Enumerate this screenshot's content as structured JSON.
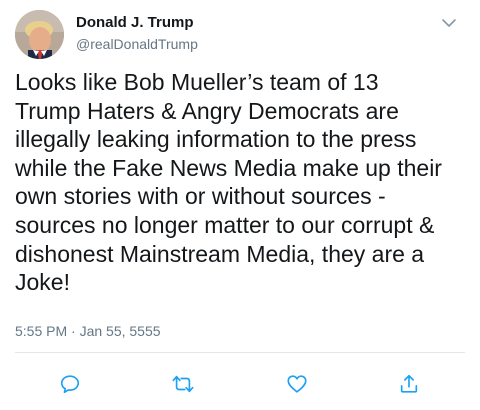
{
  "author": {
    "name": "Donald J. Trump",
    "handle": "@realDonaldTrump"
  },
  "tweet": {
    "text": "Looks like Bob Mueller’s team of 13\nTrump Haters & Angry Democrats are\nillegally leaking information to the press\nwhile the Fake News Media make up their\nown stories with or without sources -\nsources no longer matter to our corrupt &\ndishonest Mainstream Media, they are a\nJoke!",
    "timestamp": "5:55 PM · Jan 55, 5555"
  },
  "icons": {
    "more": "chevron-down-icon",
    "reply": "reply-icon",
    "retweet": "retweet-icon",
    "like": "like-icon",
    "share": "share-icon"
  },
  "colors": {
    "text": "#14171a",
    "secondary": "#657786",
    "icon": "#1da1f2"
  }
}
